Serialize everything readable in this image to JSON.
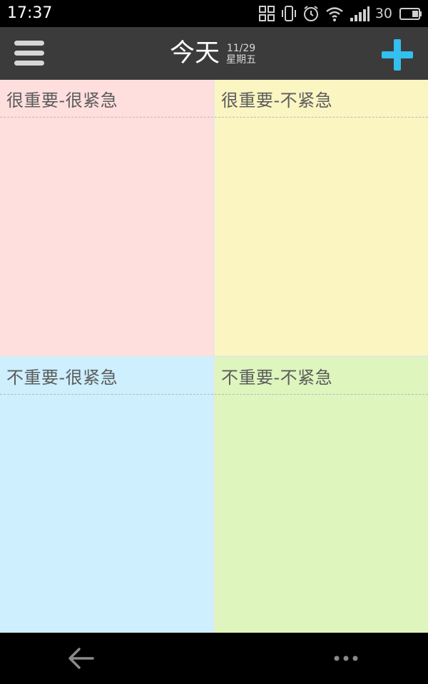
{
  "status_bar": {
    "time": "17:37",
    "battery_level": "30",
    "icons": [
      "scan-icon",
      "vibrate-icon",
      "alarm-icon",
      "wifi-icon",
      "signal-icon",
      "battery-icon"
    ]
  },
  "app_bar": {
    "title": "今天",
    "date": "11/29",
    "weekday": "星期五",
    "menu_icon": "hamburger-menu-icon",
    "add_icon": "plus-icon",
    "accent_color": "#33bfef"
  },
  "quadrants": [
    {
      "title": "很重要-很紧急",
      "color": "#ffdfde"
    },
    {
      "title": "很重要-不紧急",
      "color": "#fbf5c2"
    },
    {
      "title": "不重要-很紧急",
      "color": "#cdeffe"
    },
    {
      "title": "不重要-不紧急",
      "color": "#def5be"
    }
  ],
  "nav_bar": {
    "back_icon": "back-arrow-icon",
    "more_icon": "more-dots-icon"
  }
}
